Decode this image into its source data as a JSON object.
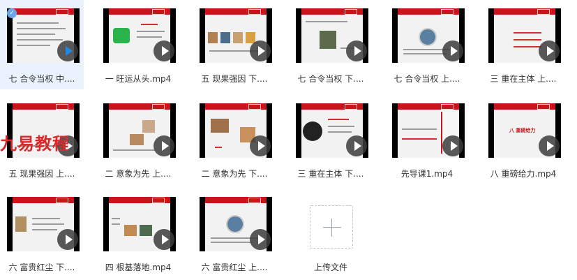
{
  "files": [
    {
      "name": "七 合令当权 中....",
      "selected": true
    },
    {
      "name": "一 旺运从头.mp4"
    },
    {
      "name": "五 现果强因 下...."
    },
    {
      "name": "七 合令当权 下...."
    },
    {
      "name": "七 合令当权 上...."
    },
    {
      "name": "三 重在主体 上...."
    },
    {
      "name": "五 现果强因 上...."
    },
    {
      "name": "二 意象为先 上...."
    },
    {
      "name": "二 意象为先 下...."
    },
    {
      "name": "三 重在主体 下...."
    },
    {
      "name": "先导课1.mp4"
    },
    {
      "name": "八 重磅给力.mp4"
    },
    {
      "name": "六 富贵红尘 下...."
    },
    {
      "name": "四 根基落地.mp4"
    },
    {
      "name": "六 富贵红尘 上...."
    }
  ],
  "overlay_text": {
    "watermark": "九易教程"
  },
  "slide_text": {
    "eight": "八 重磅给力"
  },
  "upload": {
    "label": "上传文件"
  },
  "colors": {
    "accent": "#c8141b",
    "selected_bg": "#eaf3fd"
  }
}
